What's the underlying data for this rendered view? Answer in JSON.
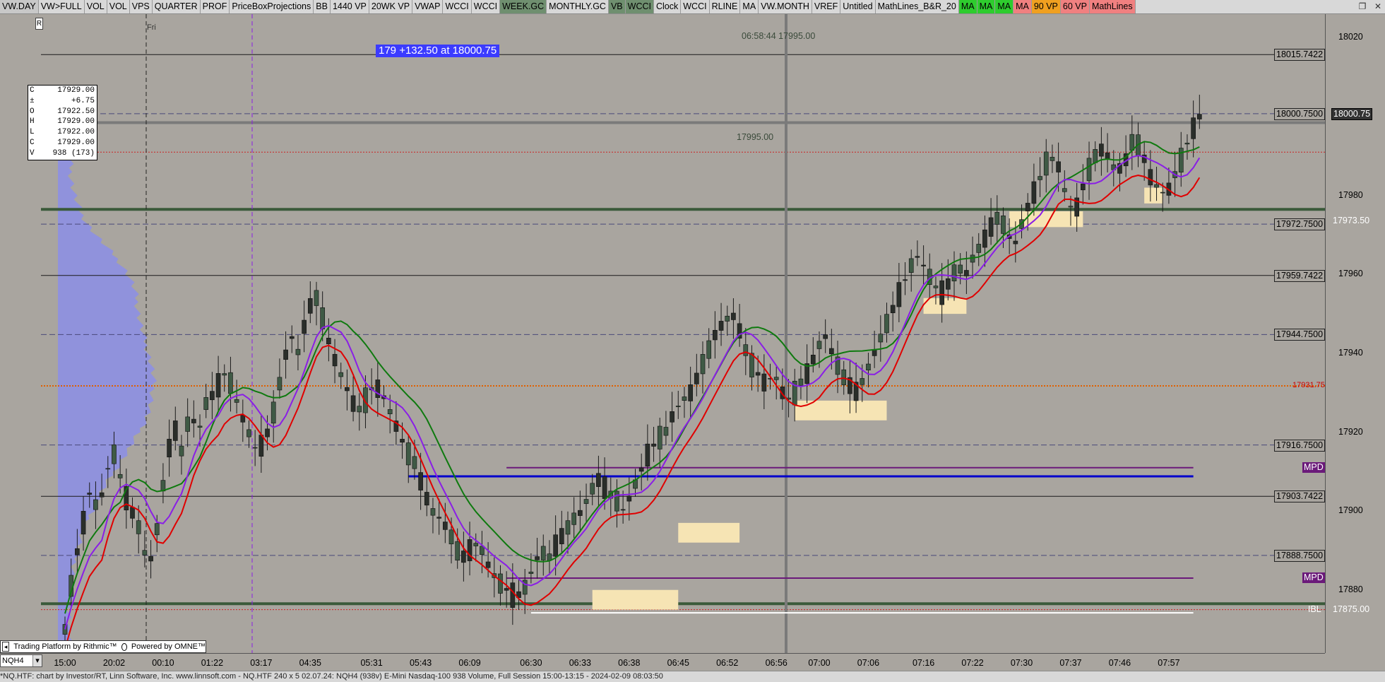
{
  "toolbar": {
    "buttons": [
      {
        "label": "VW.DAY",
        "bg": "#c8c8c8"
      },
      {
        "label": "VW>FULL",
        "bg": "#d8d8d8"
      },
      {
        "label": "VOL",
        "bg": "#d8d8d8"
      },
      {
        "label": "VOL",
        "bg": "#d8d8d8"
      },
      {
        "label": "VPS",
        "bg": "#d8d8d8"
      },
      {
        "label": "QUARTER",
        "bg": "#d8d8d8"
      },
      {
        "label": "PROF",
        "bg": "#d8d8d8"
      },
      {
        "label": "PriceBoxProjections",
        "bg": "#d8d8d8"
      },
      {
        "label": "BB",
        "bg": "#d8d8d8"
      },
      {
        "label": "1440 VP",
        "bg": "#d8d8d8"
      },
      {
        "label": "20WK VP",
        "bg": "#d8d8d8"
      },
      {
        "label": "VWAP",
        "bg": "#d8d8d8"
      },
      {
        "label": "WCCI",
        "bg": "#d8d8d8"
      },
      {
        "label": "WCCI",
        "bg": "#d8d8d8"
      },
      {
        "label": "WEEK.GC",
        "bg": "#6f8f6f"
      },
      {
        "label": "MONTHLY.GC",
        "bg": "#d8d8d8"
      },
      {
        "label": "VB",
        "bg": "#6f8f6f"
      },
      {
        "label": "WCCI",
        "bg": "#6f8f6f"
      },
      {
        "label": "Clock",
        "bg": "#d8d8d8"
      },
      {
        "label": "WCCI",
        "bg": "#d8d8d8"
      },
      {
        "label": "RLINE",
        "bg": "#d8d8d8"
      },
      {
        "label": "MA",
        "bg": "#d8d8d8"
      },
      {
        "label": "VW.MONTH",
        "bg": "#d8d8d8"
      },
      {
        "label": "VREF",
        "bg": "#d8d8d8"
      },
      {
        "label": "Untitled",
        "bg": "#d8d8d8"
      },
      {
        "label": "MathLines_B&R_20",
        "bg": "#d8d8d8"
      },
      {
        "label": "MA",
        "bg": "#2ecc2e"
      },
      {
        "label": "MA",
        "bg": "#2ecc2e"
      },
      {
        "label": "MA",
        "bg": "#2ecc2e"
      },
      {
        "label": "MA",
        "bg": "#f08080"
      },
      {
        "label": "90 VP",
        "bg": "#f0a020"
      },
      {
        "label": "60 VP",
        "bg": "#f08080"
      },
      {
        "label": "MathLines",
        "bg": "#f08080"
      }
    ],
    "window_controls": [
      "restore-icon",
      "close-icon"
    ]
  },
  "ohlc": [
    {
      "k": "C",
      "v": "17929.00"
    },
    {
      "k": "±",
      "v": "+6.75"
    },
    {
      "k": "O",
      "v": "17922.50"
    },
    {
      "k": "H",
      "v": "17929.00"
    },
    {
      "k": "L",
      "v": "17922.00"
    },
    {
      "k": "C",
      "v": "17929.00"
    },
    {
      "k": "V",
      "v": "938  (173)"
    }
  ],
  "banner": "179  +132.50 at 18000.75",
  "clock": "06:58:44  17995.00",
  "mid_price": "17995.00",
  "fri_label": "Fri",
  "r_marker": "R",
  "powered": {
    "left": "Trading Platform by Rithmic™",
    "right": "Powered by OMNE™"
  },
  "symbol": "NQH4",
  "status": "*NQ.HTF: chart by Investor/RT, Linn Software, Inc. www.linnsoft.com - NQ.HTF  240 x 5      02.07.24: NQH4 (938v) E-Mini Nasdaq-100 938 Volume, Full Session 15:00-13:15 - 2024-02-09 08:03:50",
  "price_labels": [
    {
      "text": "18015.7422",
      "price": 18015.7422,
      "style": "box"
    },
    {
      "text": "18000.7500",
      "price": 18000.75,
      "style": "box"
    },
    {
      "text": "17972.7500",
      "price": 17972.75,
      "style": "box"
    },
    {
      "text": "17959.7422",
      "price": 17959.7422,
      "style": "box"
    },
    {
      "text": "17944.7500",
      "price": 17944.75,
      "style": "box"
    },
    {
      "text": "17931.75",
      "price": 17931.75,
      "style": "red"
    },
    {
      "text": "17916.7500",
      "price": 17916.75,
      "style": "box"
    },
    {
      "text": "MPD",
      "price": 17911,
      "style": "purple"
    },
    {
      "text": "17903.7422",
      "price": 17903.7422,
      "style": "box"
    },
    {
      "text": "17888.7500",
      "price": 17888.75,
      "style": "box"
    },
    {
      "text": "MPD",
      "price": 17883,
      "style": "purple"
    },
    {
      "text": "IBL",
      "price": 17875,
      "style": "ibl"
    }
  ],
  "axis_right_labels": [
    {
      "text": "18000.75",
      "price": 18000.75,
      "style": "dark"
    },
    {
      "text": "17973.50",
      "price": 17973.5,
      "style": "light"
    },
    {
      "text": "17875.00",
      "price": 17875,
      "style": "light"
    }
  ],
  "colors": {
    "background": "#a9a59f",
    "candle_up": "#3f5a45",
    "candle_down": "#2a2e2a",
    "ma_green": "#0f7a0f",
    "ma_purple": "#8a1ee6",
    "ma_red": "#e00000",
    "volume_profile": "#8c8ee6",
    "value_box": "#f6e4b4",
    "mpd": "#6b1a7a",
    "vwap_line": "#0000cc",
    "orange_line": "#e06000"
  },
  "chart_data": {
    "type": "candlestick",
    "symbol": "NQH4",
    "y_ticks": [
      18020,
      18000,
      17980,
      17960,
      17940,
      17920,
      17900,
      17880
    ],
    "ylim": [
      17864,
      18026
    ],
    "x_ticks": [
      "15:00",
      "20:02",
      "00:10",
      "01:22",
      "03:17",
      "04:35",
      "05:31",
      "05:43",
      "06:09",
      "06:30",
      "06:33",
      "06:38",
      "06:45",
      "06:52",
      "06:56",
      "07:00",
      "07:06",
      "07:16",
      "07:22",
      "07:30",
      "07:37",
      "07:46",
      "07:57"
    ],
    "x_tick_bar_index": [
      0,
      8,
      16,
      24,
      32,
      40,
      50,
      58,
      66,
      76,
      84,
      92,
      100,
      108,
      116,
      123,
      131,
      140,
      148,
      156,
      164,
      172,
      180
    ],
    "horizontal_levels": [
      {
        "price": 18015.7422,
        "style": "solid",
        "color": "#1a1a1a"
      },
      {
        "price": 18000.75,
        "style": "dashed",
        "color": "#4a4a7a"
      },
      {
        "price": 17998.5,
        "style": "solid-thick",
        "color": "#7a7a7a"
      },
      {
        "price": 17991,
        "style": "dotted",
        "color": "#cc2222"
      },
      {
        "price": 17976.5,
        "style": "solid-thick",
        "color": "#3a5a3a"
      },
      {
        "price": 17972.75,
        "style": "dashed",
        "color": "#4a4a7a"
      },
      {
        "price": 17959.7422,
        "style": "solid",
        "color": "#1a1a1a"
      },
      {
        "price": 17944.75,
        "style": "dashed",
        "color": "#4a4a7a"
      },
      {
        "price": 17931.75,
        "style": "dotted-thick",
        "color": "#e06000"
      },
      {
        "price": 17916.75,
        "style": "dashed",
        "color": "#4a4a7a"
      },
      {
        "price": 17903.7422,
        "style": "solid",
        "color": "#1a1a1a"
      },
      {
        "price": 17888.75,
        "style": "dashed",
        "color": "#4a4a7a"
      },
      {
        "price": 17876.5,
        "style": "solid-thick",
        "color": "#3a5a3a"
      },
      {
        "price": 17875,
        "style": "dotted",
        "color": "#cc2222"
      }
    ],
    "segments": [
      {
        "from": 56,
        "to": 184,
        "price": 17908.8,
        "color": "#0000cc",
        "width": 3
      },
      {
        "from": 72,
        "to": 184,
        "price": 17911,
        "color": "#6b1a7a",
        "width": 2
      },
      {
        "from": 72,
        "to": 184,
        "price": 17883,
        "color": "#6b1a7a",
        "width": 2
      },
      {
        "from": 76,
        "to": 184,
        "price": 17874.2,
        "color": "#ffffff",
        "width": 2
      }
    ],
    "value_boxes": [
      {
        "from": 86,
        "to": 100,
        "low": 17875,
        "high": 17880
      },
      {
        "from": 100,
        "to": 110,
        "low": 17892,
        "high": 17897
      },
      {
        "from": 119,
        "to": 134,
        "low": 17923,
        "high": 17928
      },
      {
        "from": 140,
        "to": 147,
        "low": 17950,
        "high": 17954
      },
      {
        "from": 154,
        "to": 166,
        "low": 17972,
        "high": 17976
      },
      {
        "from": 176,
        "to": 179,
        "low": 17978,
        "high": 17982
      }
    ],
    "candles_seed": {
      "start": 17870,
      "path": [
        17870,
        17885,
        17895,
        17905,
        17900,
        17910,
        17915,
        17905,
        17900,
        17895,
        17885,
        17895,
        17910,
        17922,
        17915,
        17925,
        17920,
        17928,
        17930,
        17935,
        17932,
        17925,
        17920,
        17915,
        17918,
        17925,
        17935,
        17945,
        17940,
        17950,
        17955,
        17948,
        17940,
        17935,
        17930,
        17925,
        17928,
        17932,
        17930,
        17925,
        17920,
        17915,
        17912,
        17905,
        17900,
        17898,
        17895,
        17890,
        17888,
        17892,
        17890,
        17885,
        17882,
        17880,
        17878,
        17880,
        17885,
        17890,
        17888,
        17892,
        17895,
        17898,
        17900,
        17905,
        17908,
        17905,
        17903,
        17900,
        17905,
        17910,
        17915,
        17918,
        17920,
        17925,
        17928,
        17930,
        17935,
        17940,
        17945,
        17948,
        17950,
        17945,
        17938,
        17935,
        17932,
        17935,
        17930,
        17928,
        17932,
        17935,
        17940,
        17945,
        17940,
        17935,
        17932,
        17930,
        17935,
        17940,
        17945,
        17950,
        17955,
        17960,
        17965,
        17962,
        17958,
        17955,
        17958,
        17962,
        17960,
        17965,
        17968,
        17972,
        17975,
        17970,
        17968,
        17975,
        17980,
        17985,
        17990,
        17988,
        17980,
        17975,
        17982,
        17988,
        17992,
        17990,
        17986,
        17988,
        17994,
        17992,
        17985,
        17982,
        17980,
        17985,
        17990,
        17996,
        18000
      ]
    },
    "moving_averages": [
      {
        "name": "MA",
        "color": "#0f7a0f",
        "lag": 9,
        "offset": 4
      },
      {
        "name": "MA",
        "color": "#8a1ee6",
        "lag": 6,
        "offset": 0
      },
      {
        "name": "MA",
        "color": "#e00000",
        "lag": 6,
        "offset": -5
      }
    ]
  }
}
